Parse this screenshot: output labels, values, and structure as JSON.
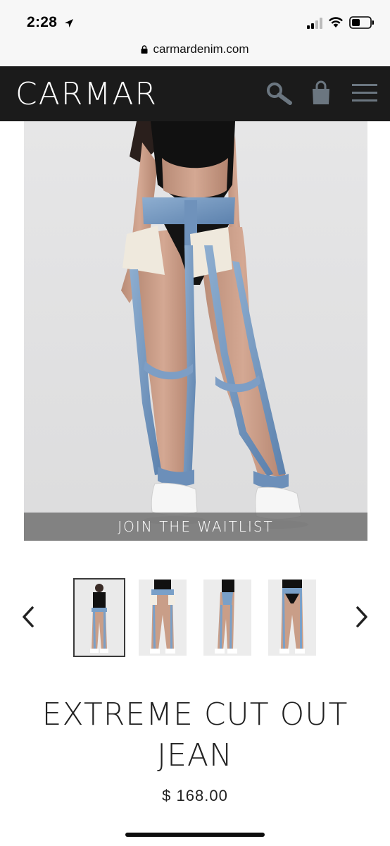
{
  "status_bar": {
    "time": "2:28",
    "icons": [
      "location-arrow-icon",
      "cellular-signal-icon",
      "wifi-icon",
      "battery-icon"
    ]
  },
  "browser": {
    "url": "carmardenim.com",
    "secure_icon": "lock-icon"
  },
  "header": {
    "logo": "CARMAR",
    "icons": [
      "search-icon",
      "shopping-bag-icon",
      "menu-icon"
    ],
    "background": "#1b1b1b"
  },
  "hero": {
    "waitlist_label": "JOIN THE WAITLIST"
  },
  "gallery": {
    "prev_icon": "chevron-left-icon",
    "next_icon": "chevron-right-icon",
    "thumbnail_count": 4,
    "selected_index": 0
  },
  "product": {
    "title_line1": "EXTREME CUT OUT",
    "title_line2": "JEAN",
    "price": "$ 168.00"
  }
}
